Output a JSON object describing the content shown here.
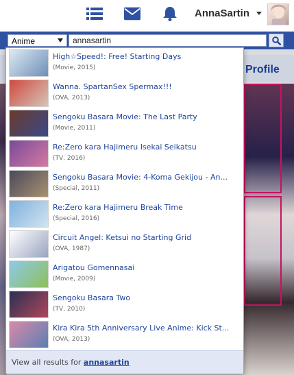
{
  "header": {
    "username": "AnnaSartin",
    "icons": [
      "list-icon",
      "mail-icon",
      "bell-icon"
    ],
    "accent": "#2e51a2"
  },
  "search": {
    "type_selected": "Anime",
    "query": "annasartin"
  },
  "background_page": {
    "tab_label": "Profile"
  },
  "results": [
    {
      "title": "High☆Speed!: Free! Starting Days",
      "meta": "(Movie, 2015)",
      "thumb_colors": [
        "#dbe9f3",
        "#6f8fb8"
      ]
    },
    {
      "title": "Wanna. SpartanSex Spermax!!!",
      "meta": "(OVA, 2013)",
      "thumb_colors": [
        "#cf4a3f",
        "#d7c4b9"
      ]
    },
    {
      "title": "Sengoku Basara Movie: The Last Party",
      "meta": "(Movie, 2011)",
      "thumb_colors": [
        "#6a3a2a",
        "#3a4a8a"
      ]
    },
    {
      "title": "Re:Zero kara Hajimeru Isekai Seikatsu",
      "meta": "(TV, 2016)",
      "thumb_colors": [
        "#7a4a9a",
        "#d47aa0"
      ]
    },
    {
      "title": "Sengoku Basara Movie: 4-Koma Gekijou - An...",
      "meta": "(Special, 2011)",
      "thumb_colors": [
        "#4a4a5a",
        "#a89070"
      ]
    },
    {
      "title": "Re:Zero kara Hajimeru Break Time",
      "meta": "(Special, 2016)",
      "thumb_colors": [
        "#7fb2e0",
        "#d2e3ee"
      ]
    },
    {
      "title": "Circuit Angel: Ketsui no Starting Grid",
      "meta": "(OVA, 1987)",
      "thumb_colors": [
        "#ffffff",
        "#9aa4c0"
      ]
    },
    {
      "title": "Arigatou Gomennasai",
      "meta": "(Movie, 2009)",
      "thumb_colors": [
        "#8ec9e8",
        "#8fbf5a"
      ]
    },
    {
      "title": "Sengoku Basara Two",
      "meta": "(TV, 2010)",
      "thumb_colors": [
        "#2a2f55",
        "#b0475a"
      ]
    },
    {
      "title": "Kira Kira 5th Anniversary Live Anime: Kick St...",
      "meta": "(OVA, 2013)",
      "thumb_colors": [
        "#d98aa8",
        "#5b7fb3"
      ]
    }
  ],
  "footer": {
    "prefix": "View all results for ",
    "query_link": "annasartin"
  }
}
